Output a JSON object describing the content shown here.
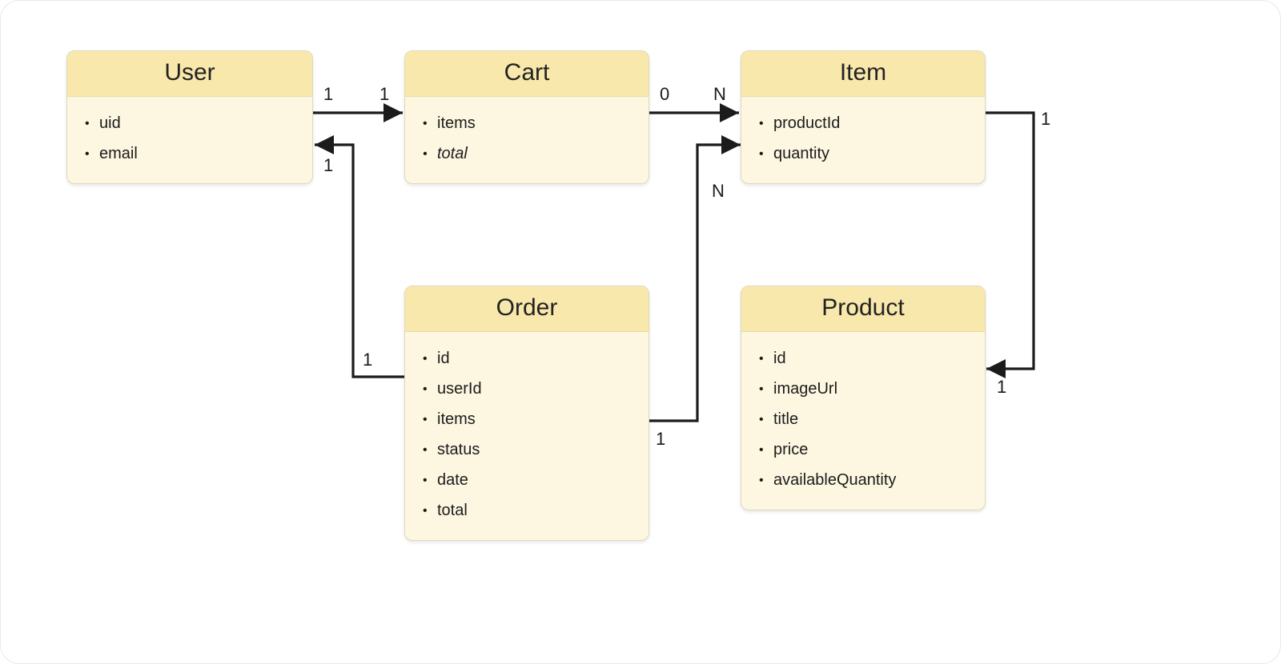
{
  "entities": {
    "user": {
      "title": "User",
      "attrs": [
        "uid",
        "email"
      ]
    },
    "cart": {
      "title": "Cart",
      "attrs": [
        "items",
        "total"
      ],
      "italic_attrs": [
        "total"
      ]
    },
    "item": {
      "title": "Item",
      "attrs": [
        "productId",
        "quantity"
      ]
    },
    "order": {
      "title": "Order",
      "attrs": [
        "id",
        "userId",
        "items",
        "status",
        "date",
        "total"
      ]
    },
    "product": {
      "title": "Product",
      "attrs": [
        "id",
        "imageUrl",
        "title",
        "price",
        "availableQuantity"
      ]
    }
  },
  "relationships": [
    {
      "from": "User",
      "to": "Cart",
      "from_card": "1",
      "to_card": "1"
    },
    {
      "from": "Cart",
      "to": "Item",
      "from_card": "0",
      "to_card": "N"
    },
    {
      "from": "Order",
      "to": "User",
      "from_card": "1",
      "to_card": "1"
    },
    {
      "from": "Order",
      "to": "Item",
      "from_card": "1",
      "to_card": "N"
    },
    {
      "from": "Item",
      "to": "Product",
      "from_card": "1",
      "to_card": "1"
    }
  ],
  "cardinality_labels": {
    "user_cart_from": "1",
    "user_cart_to": "1",
    "cart_item_from": "0",
    "cart_item_to": "N",
    "order_user_from": "1",
    "order_user_to": "1",
    "order_item_from": "1",
    "order_item_to": "N",
    "item_product_from": "1",
    "item_product_to": "1"
  },
  "chart_data": {
    "type": "er-diagram",
    "entities": [
      {
        "name": "User",
        "attributes": [
          "uid",
          "email"
        ]
      },
      {
        "name": "Cart",
        "attributes": [
          "items",
          "total"
        ],
        "derived": [
          "total"
        ]
      },
      {
        "name": "Item",
        "attributes": [
          "productId",
          "quantity"
        ]
      },
      {
        "name": "Order",
        "attributes": [
          "id",
          "userId",
          "items",
          "status",
          "date",
          "total"
        ]
      },
      {
        "name": "Product",
        "attributes": [
          "id",
          "imageUrl",
          "title",
          "price",
          "availableQuantity"
        ]
      }
    ],
    "relationships": [
      {
        "from": "User",
        "to": "Cart",
        "cardinality": "1:1"
      },
      {
        "from": "Cart",
        "to": "Item",
        "cardinality": "0:N"
      },
      {
        "from": "Order",
        "to": "User",
        "cardinality": "1:1"
      },
      {
        "from": "Order",
        "to": "Item",
        "cardinality": "1:N"
      },
      {
        "from": "Item",
        "to": "Product",
        "cardinality": "1:1"
      }
    ]
  }
}
